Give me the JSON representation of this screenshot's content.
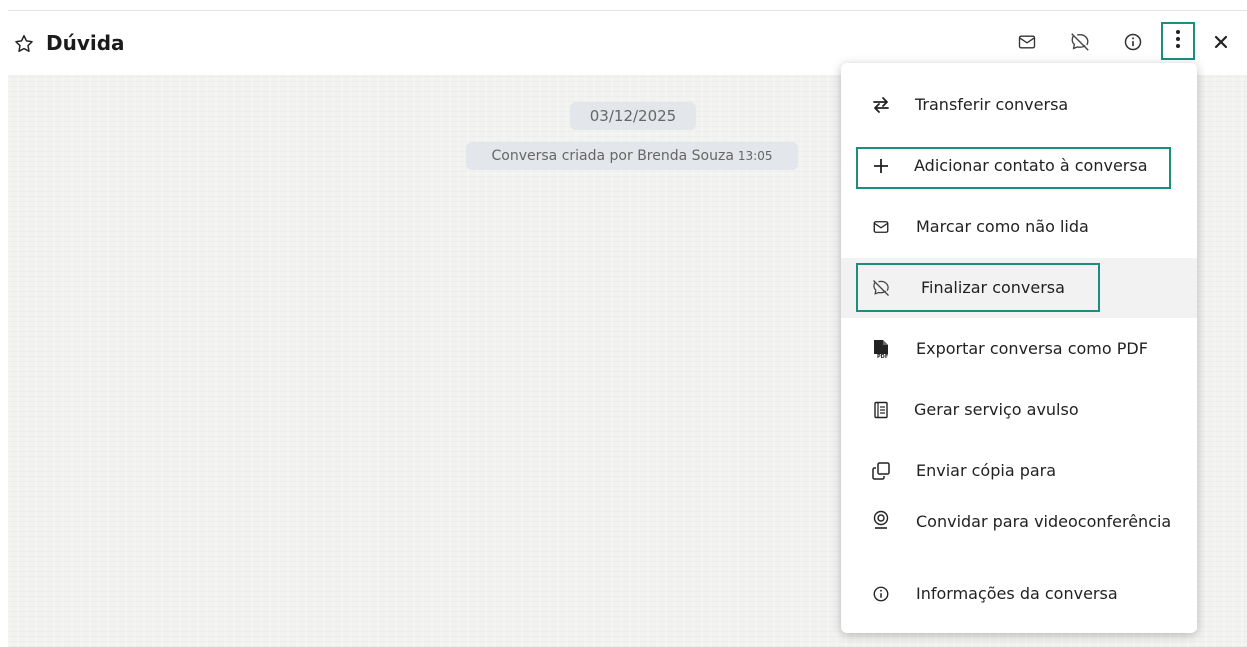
{
  "header": {
    "title": "Dúvida",
    "icons": [
      "star-icon",
      "mail-icon",
      "chat-off-icon",
      "info-icon",
      "more-vertical-icon",
      "close-icon"
    ]
  },
  "chat": {
    "date_label": "03/12/2025",
    "event_text": "Conversa criada por Brenda Souza",
    "event_time": "13:05"
  },
  "menu": {
    "items": [
      {
        "label": "Transferir conversa",
        "icon": "transfer-icon"
      },
      {
        "label": "Adicionar contato à conversa",
        "icon": "plus-icon"
      },
      {
        "label": "Marcar como não lida",
        "icon": "mail-icon"
      },
      {
        "label": "Finalizar conversa",
        "icon": "chat-off-icon"
      },
      {
        "label": "Exportar conversa como PDF",
        "icon": "pdf-icon"
      },
      {
        "label": "Gerar serviço avulso",
        "icon": "document-icon"
      },
      {
        "label": "Enviar cópia para",
        "icon": "copy-icon"
      },
      {
        "label": "Convidar para videoconferência",
        "icon": "webcam-icon"
      },
      {
        "label": "Informações da conversa",
        "icon": "info-icon"
      }
    ]
  },
  "colors": {
    "highlight": "#1a8f7e",
    "chat_bg": "#f2f2f1",
    "pill_bg": "#e3e6ea"
  }
}
